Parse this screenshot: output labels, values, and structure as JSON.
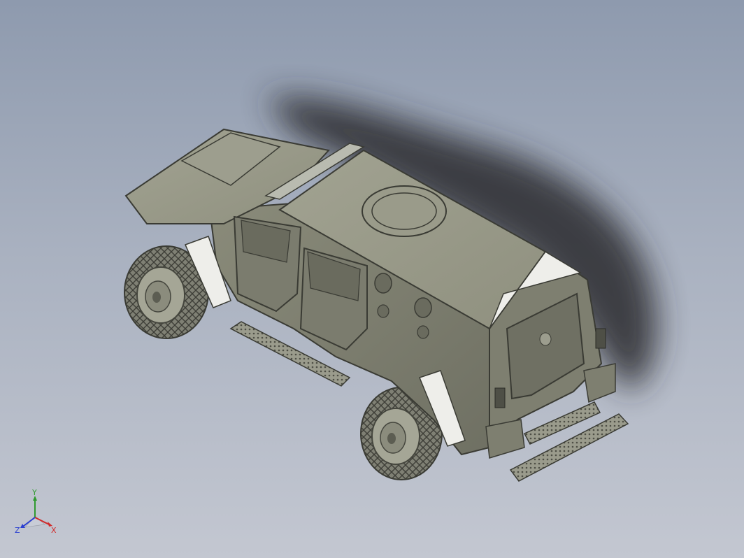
{
  "viewport": {
    "background_top": "#8e9aae",
    "background_bottom": "#c3c7d1"
  },
  "model": {
    "body_color": "#8d8e7d",
    "shadow_color": "#2a2c2e",
    "tire_color": "#7d7e72",
    "highlight_color": "#eeeeea"
  },
  "triad": {
    "y_label": "Y",
    "x_label": "X",
    "z_label": "Z",
    "y_color": "#2f9a2f",
    "x_color": "#d02a2a",
    "z_color": "#2a3fd0"
  }
}
